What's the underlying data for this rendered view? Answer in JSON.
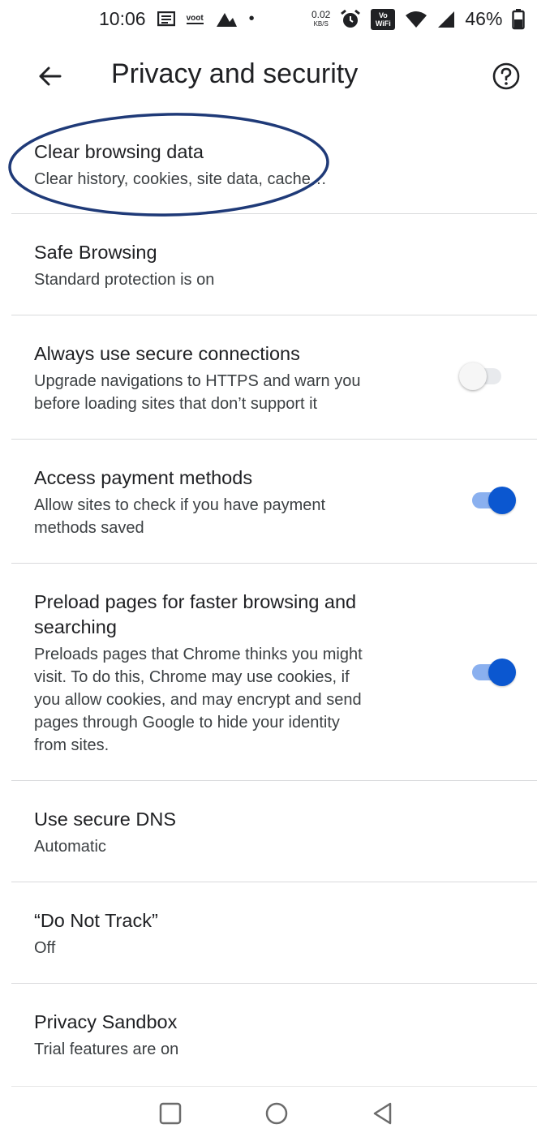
{
  "status_bar": {
    "time": "10:06",
    "voot_label": "voot",
    "dot": "•",
    "net_speed_value": "0.02",
    "net_speed_unit": "KB/S",
    "wifi_badge_top": "Vo",
    "wifi_badge_bottom": "WiFi",
    "battery": "46%"
  },
  "toolbar": {
    "title": "Privacy and security"
  },
  "settings": [
    {
      "title": "Clear browsing data",
      "summary": "Clear history, cookies, site data, cache…"
    },
    {
      "title": "Safe Browsing",
      "summary": "Standard protection is on"
    },
    {
      "title": "Always use secure connections",
      "summary_lines": [
        "Upgrade navigations to HTTPS and warn you",
        "before loading sites that don’t support it"
      ],
      "toggle": false
    },
    {
      "title": "Access payment methods",
      "summary_lines": [
        "Allow sites to check if you have payment",
        "methods saved"
      ],
      "toggle": true
    },
    {
      "title_lines": [
        "Preload pages for faster browsing and",
        "searching"
      ],
      "summary_lines": [
        "Preloads pages that Chrome thinks you might",
        "visit. To do this, Chrome may use cookies, if",
        "you allow cookies, and may encrypt and send",
        "pages through Google to hide your identity",
        "from sites."
      ],
      "toggle": true
    },
    {
      "title": "Use secure DNS",
      "summary": "Automatic"
    },
    {
      "title": "“Do Not Track”",
      "summary": "Off"
    },
    {
      "title": "Privacy Sandbox",
      "summary": "Trial features are on"
    }
  ],
  "colors": {
    "accent": "#0b57d0",
    "annotation": "#1f3a78"
  }
}
